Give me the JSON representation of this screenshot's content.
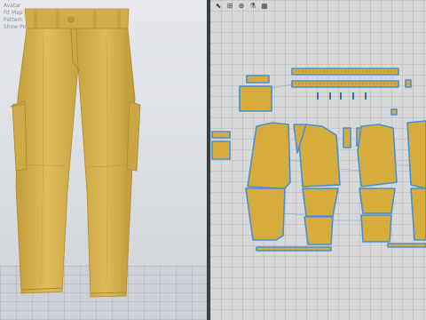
{
  "viewport3d": {
    "overlay_lines": [
      "Avatar",
      "Fit Map",
      "Pattern",
      "Show Position Points"
    ],
    "garment_color": "#d4b24c"
  },
  "toolbar2d": {
    "icons": [
      "select-icon",
      "transform-icon",
      "zoom-icon",
      "arrange-icon",
      "grid-icon"
    ]
  },
  "pattern_color": "#d6ad3d",
  "outline_color": "#4a8fd0"
}
